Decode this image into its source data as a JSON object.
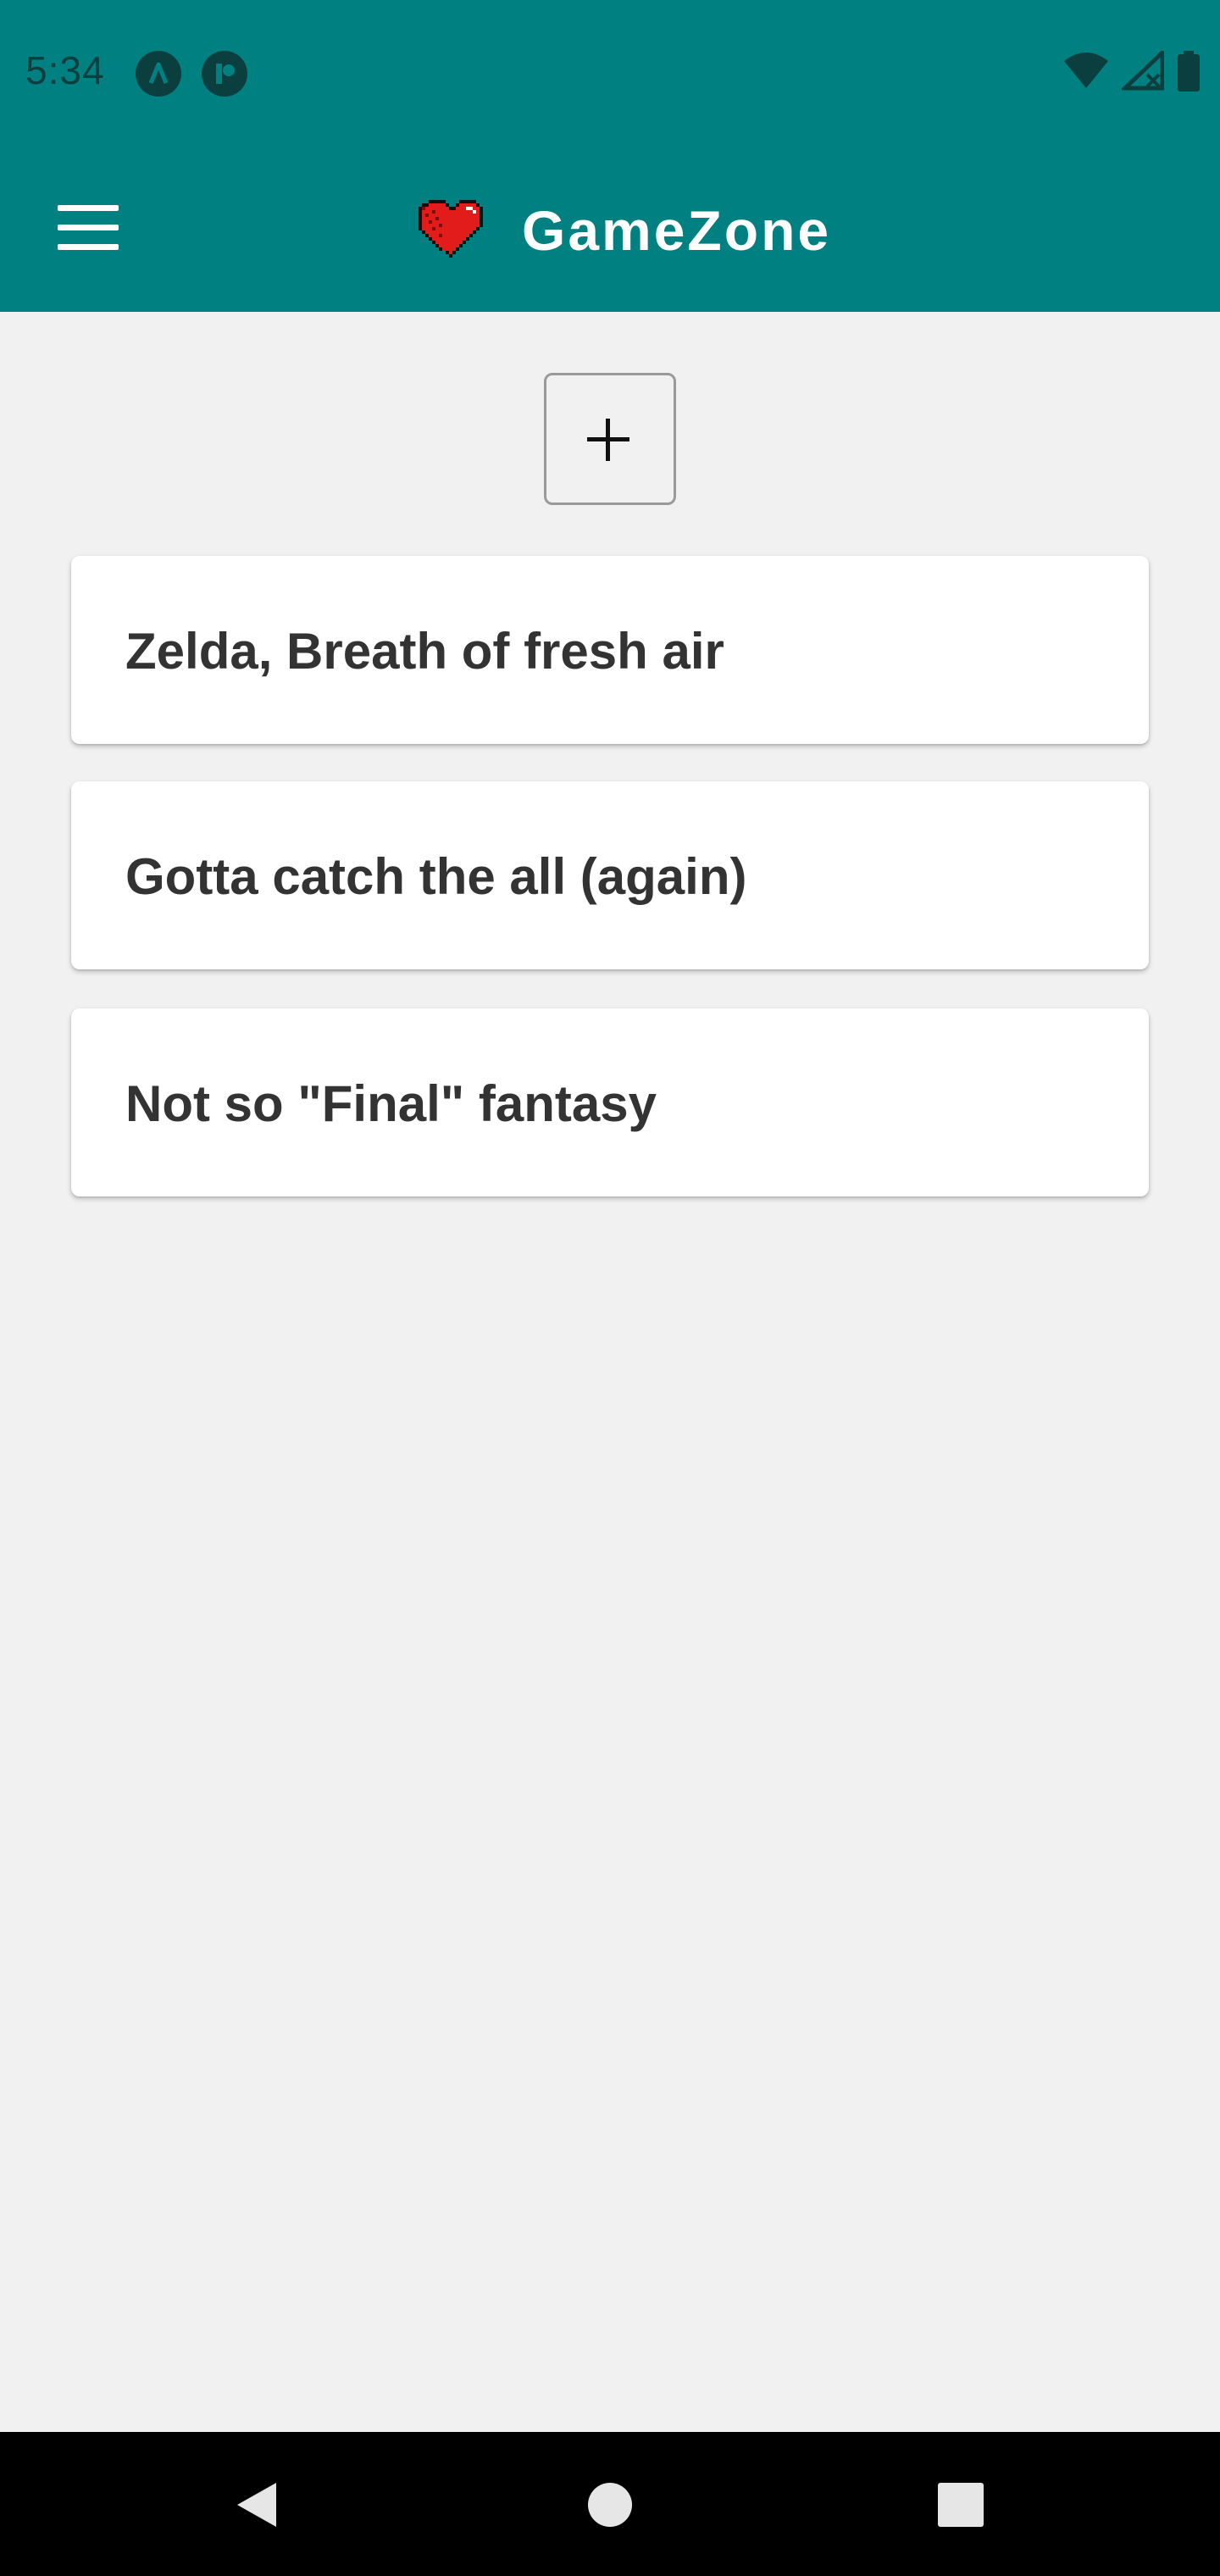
{
  "status_bar": {
    "time": "5:34",
    "icons": [
      "app-a-icon",
      "app-b-icon",
      "wifi-icon",
      "signal-icon",
      "battery-icon"
    ]
  },
  "app_bar": {
    "title": "GameZone",
    "menu_icon": "hamburger-menu-icon",
    "logo_icon": "pixel-heart-icon",
    "color": "#008080"
  },
  "add_button": {
    "icon": "plus-icon"
  },
  "cards": [
    {
      "title": "Zelda, Breath of fresh air"
    },
    {
      "title": "Gotta catch the all (again)"
    },
    {
      "title": "Not so \"Final\" fantasy"
    }
  ],
  "nav_bar": {
    "icons": [
      "back-icon",
      "home-icon",
      "recents-icon"
    ]
  },
  "colors": {
    "primary": "#008080",
    "background": "#f1f1f1",
    "card": "#ffffff",
    "card_text": "#333333",
    "logo_red": "#e21b1b"
  }
}
